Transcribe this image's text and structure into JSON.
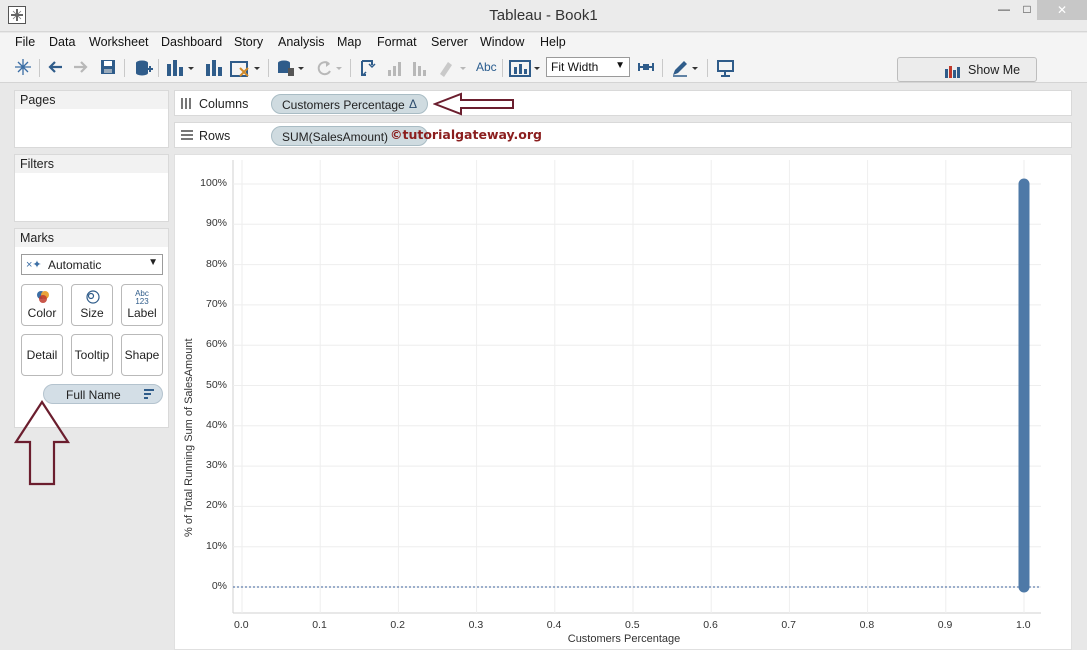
{
  "window": {
    "title": "Tableau - Book1",
    "minimize": "—",
    "maximize": "□",
    "close": "✕"
  },
  "menu": [
    "File",
    "Data",
    "Worksheet",
    "Dashboard",
    "Story",
    "Analysis",
    "Map",
    "Format",
    "Server",
    "Window",
    "Help"
  ],
  "toolbar": {
    "fit": "Fit Width",
    "abc": "Abc",
    "show_me": "Show Me"
  },
  "panes": {
    "pages": "Pages",
    "filters": "Filters",
    "marks": {
      "title": "Marks",
      "mark_type": "Automatic",
      "buttons": [
        "Color",
        "Size",
        "Label",
        "Detail",
        "Tooltip",
        "Shape"
      ],
      "label_icon_text": "Abc\n123",
      "detail_pill": "Full Name"
    }
  },
  "shelves": {
    "columns_label": "Columns",
    "columns_pill": "Customers Percentage",
    "columns_delta": "Δ",
    "rows_label": "Rows",
    "rows_pill": "SUM(SalesAmount)",
    "watermark": "©tutorialgateway.org"
  },
  "colors": {
    "mark": "#4e79a7",
    "arrow": "#6b1e2e",
    "zero_line": "#3a5f9a"
  },
  "chart_data": {
    "type": "scatter",
    "xlabel": "Customers Percentage",
    "ylabel": "% of Total Running Sum of SalesAmount",
    "xlim": [
      0.0,
      1.0
    ],
    "ylim": [
      0,
      100
    ],
    "x_ticks": [
      "0.0",
      "0.1",
      "0.2",
      "0.3",
      "0.4",
      "0.5",
      "0.6",
      "0.7",
      "0.8",
      "0.9",
      "1.0"
    ],
    "y_ticks": [
      "0%",
      "10%",
      "20%",
      "30%",
      "40%",
      "50%",
      "60%",
      "70%",
      "80%",
      "90%",
      "100%"
    ],
    "series": [
      {
        "x_value": 1.0,
        "y_from": 0,
        "y_to": 100
      }
    ],
    "grid": true
  }
}
